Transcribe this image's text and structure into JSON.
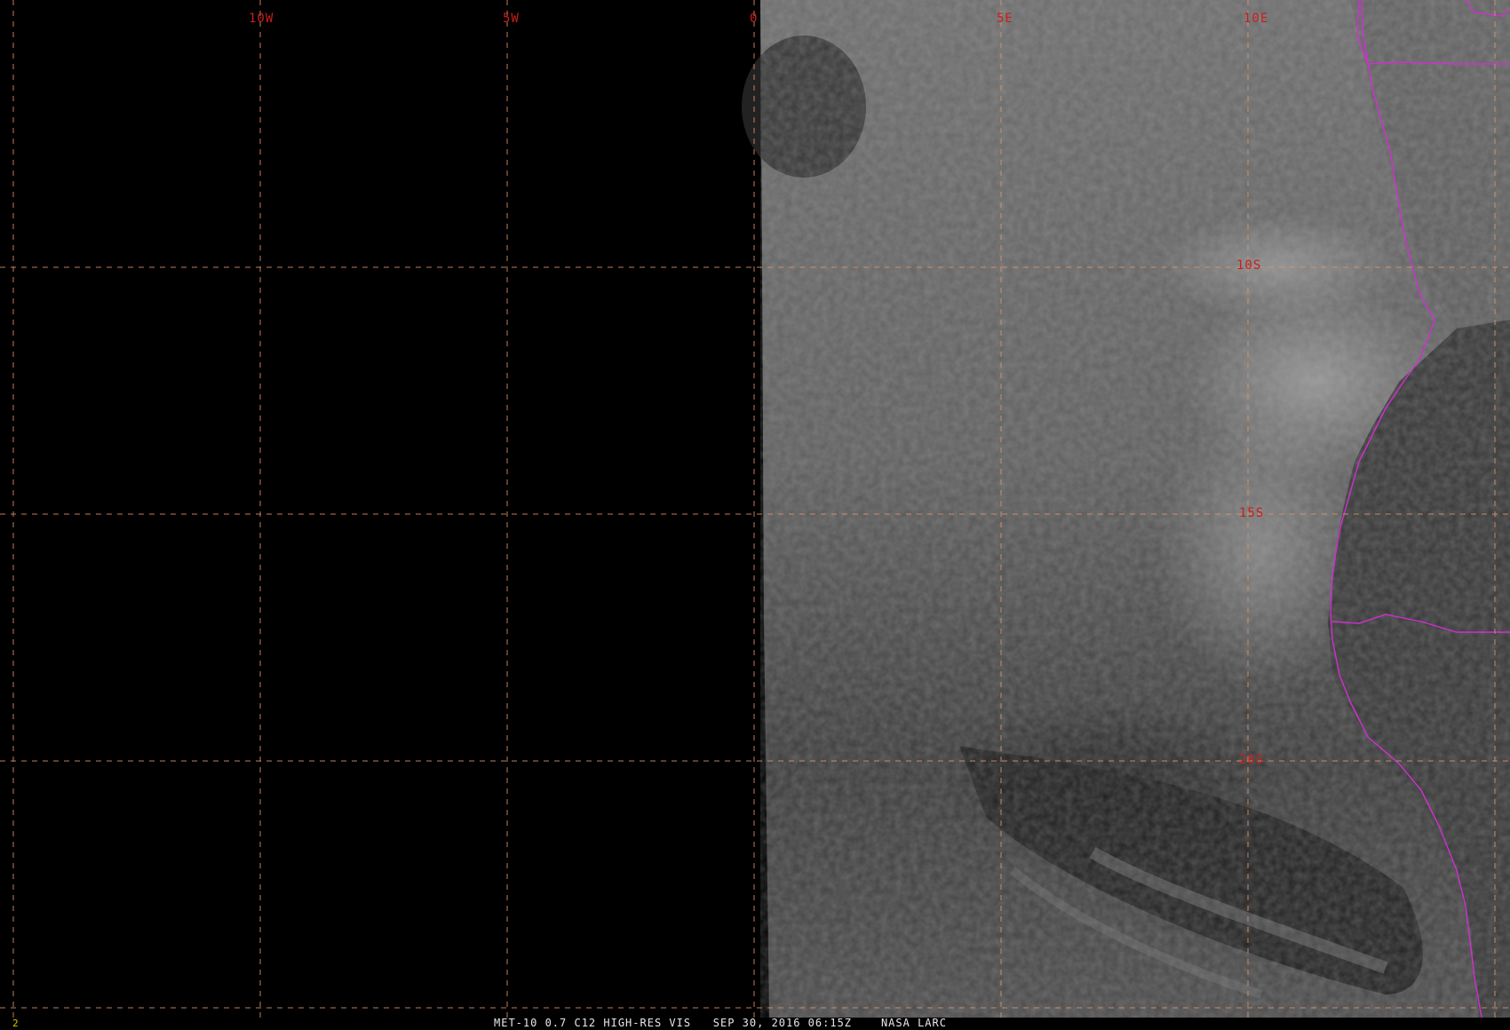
{
  "map": {
    "lon_labels": [
      "10W",
      "5W",
      "0",
      "5E",
      "10E"
    ],
    "lat_labels": [
      "10S",
      "15S",
      "20S"
    ],
    "grid_color": "#e0956a",
    "label_color": "#c81e1e",
    "border_color": "#d030d0"
  },
  "status": {
    "frame_number": "2",
    "satellite_product": "MET-10 0.7 C12 HIGH-RES VIS",
    "datetime": "SEP 30, 2016 06:15Z",
    "source": "NASA LARC"
  }
}
